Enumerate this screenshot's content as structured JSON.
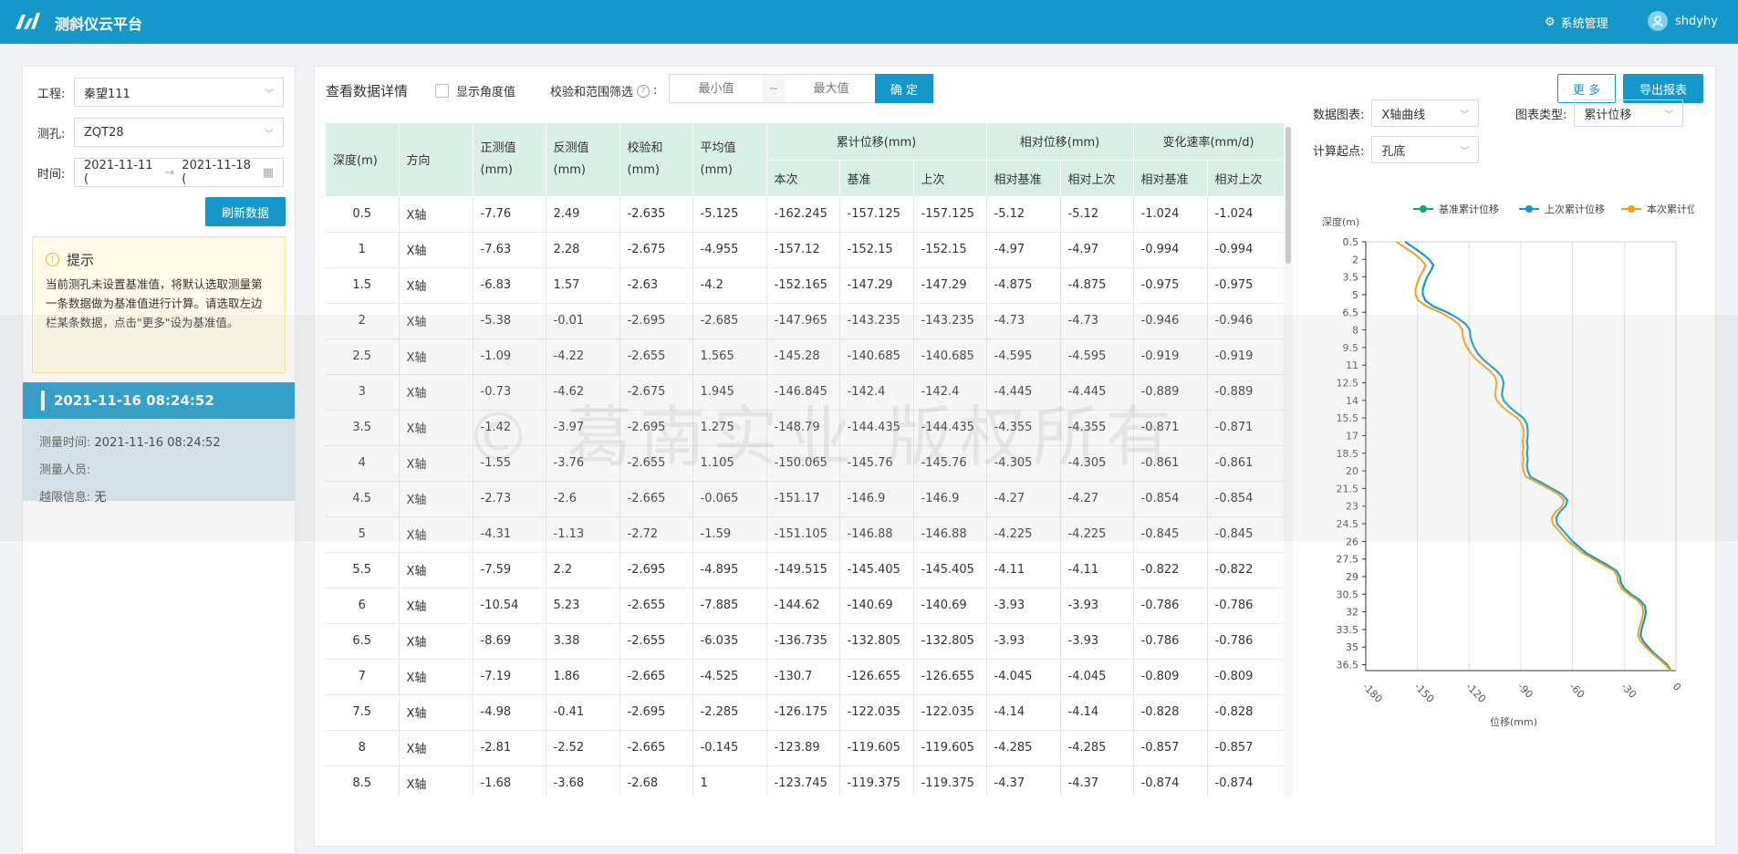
{
  "app": {
    "title": "测斜仪云平台",
    "sys_menu": "系统管理",
    "user": "shdyhy"
  },
  "sidebar": {
    "project_label": "工程:",
    "project_value": "秦望111",
    "hole_label": "测孔:",
    "hole_value": "ZQT28",
    "time_label": "时间:",
    "time_start": "2021-11-11 (",
    "time_sep": "→",
    "time_end": "2021-11-18 (",
    "refresh_label": "刷新数据",
    "tip_title": "提示",
    "tip_text": "当前测孔未设置基准值，将默认选取测量第一条数据做为基准值进行计算。请选取左边栏某条数据，点击\"更多\"设为基准值。",
    "record_title": "2021-11-16 08:24:52",
    "record_time_label": "测量时间:",
    "record_time_value": "2021-11-16 08:24:52",
    "record_person_label": "测量人员:",
    "record_person_value": "",
    "record_limit_label": "越限信息:",
    "record_limit_value": "无"
  },
  "toolbar": {
    "title": "查看数据详情",
    "show_angle": "显示角度值",
    "filter_label": "校验和范围筛选",
    "min_placeholder": "最小值",
    "max_placeholder": "最大值",
    "range_sep": "~",
    "confirm": "确 定",
    "more": "更 多",
    "export": "导出报表"
  },
  "table": {
    "h_depth": "深度(m)",
    "h_dir": "方向",
    "h_pos": "正测值(mm)",
    "h_neg": "反测值(mm)",
    "h_check": "校验和(mm)",
    "h_avg": "平均值(mm)",
    "h_cum": "累计位移(mm)",
    "h_rel": "相对位移(mm)",
    "h_rate": "变化速率(mm/d)",
    "h_cum_now": "本次",
    "h_cum_base": "基准",
    "h_cum_prev": "上次",
    "h_rel_base": "相对基准",
    "h_rel_prev": "相对上次",
    "h_rate_base": "相对基准",
    "h_rate_prev": "相对上次",
    "rows": [
      [
        "0.5",
        "X轴",
        "-7.76",
        "2.49",
        "-2.635",
        "-5.125",
        "-162.245",
        "-157.125",
        "-157.125",
        "-5.12",
        "-5.12",
        "-1.024",
        "-1.024"
      ],
      [
        "1",
        "X轴",
        "-7.63",
        "2.28",
        "-2.675",
        "-4.955",
        "-157.12",
        "-152.15",
        "-152.15",
        "-4.97",
        "-4.97",
        "-0.994",
        "-0.994"
      ],
      [
        "1.5",
        "X轴",
        "-6.83",
        "1.57",
        "-2.63",
        "-4.2",
        "-152.165",
        "-147.29",
        "-147.29",
        "-4.875",
        "-4.875",
        "-0.975",
        "-0.975"
      ],
      [
        "2",
        "X轴",
        "-5.38",
        "-0.01",
        "-2.695",
        "-2.685",
        "-147.965",
        "-143.235",
        "-143.235",
        "-4.73",
        "-4.73",
        "-0.946",
        "-0.946"
      ],
      [
        "2.5",
        "X轴",
        "-1.09",
        "-4.22",
        "-2.655",
        "1.565",
        "-145.28",
        "-140.685",
        "-140.685",
        "-4.595",
        "-4.595",
        "-0.919",
        "-0.919"
      ],
      [
        "3",
        "X轴",
        "-0.73",
        "-4.62",
        "-2.675",
        "1.945",
        "-146.845",
        "-142.4",
        "-142.4",
        "-4.445",
        "-4.445",
        "-0.889",
        "-0.889"
      ],
      [
        "3.5",
        "X轴",
        "-1.42",
        "-3.97",
        "-2.695",
        "1.275",
        "-148.79",
        "-144.435",
        "-144.435",
        "-4.355",
        "-4.355",
        "-0.871",
        "-0.871"
      ],
      [
        "4",
        "X轴",
        "-1.55",
        "-3.76",
        "-2.655",
        "1.105",
        "-150.065",
        "-145.76",
        "-145.76",
        "-4.305",
        "-4.305",
        "-0.861",
        "-0.861"
      ],
      [
        "4.5",
        "X轴",
        "-2.73",
        "-2.6",
        "-2.665",
        "-0.065",
        "-151.17",
        "-146.9",
        "-146.9",
        "-4.27",
        "-4.27",
        "-0.854",
        "-0.854"
      ],
      [
        "5",
        "X轴",
        "-4.31",
        "-1.13",
        "-2.72",
        "-1.59",
        "-151.105",
        "-146.88",
        "-146.88",
        "-4.225",
        "-4.225",
        "-0.845",
        "-0.845"
      ],
      [
        "5.5",
        "X轴",
        "-7.59",
        "2.2",
        "-2.695",
        "-4.895",
        "-149.515",
        "-145.405",
        "-145.405",
        "-4.11",
        "-4.11",
        "-0.822",
        "-0.822"
      ],
      [
        "6",
        "X轴",
        "-10.54",
        "5.23",
        "-2.655",
        "-7.885",
        "-144.62",
        "-140.69",
        "-140.69",
        "-3.93",
        "-3.93",
        "-0.786",
        "-0.786"
      ],
      [
        "6.5",
        "X轴",
        "-8.69",
        "3.38",
        "-2.655",
        "-6.035",
        "-136.735",
        "-132.805",
        "-132.805",
        "-3.93",
        "-3.93",
        "-0.786",
        "-0.786"
      ],
      [
        "7",
        "X轴",
        "-7.19",
        "1.86",
        "-2.665",
        "-4.525",
        "-130.7",
        "-126.655",
        "-126.655",
        "-4.045",
        "-4.045",
        "-0.809",
        "-0.809"
      ],
      [
        "7.5",
        "X轴",
        "-4.98",
        "-0.41",
        "-2.695",
        "-2.285",
        "-126.175",
        "-122.035",
        "-122.035",
        "-4.14",
        "-4.14",
        "-0.828",
        "-0.828"
      ],
      [
        "8",
        "X轴",
        "-2.81",
        "-2.52",
        "-2.665",
        "-0.145",
        "-123.89",
        "-119.605",
        "-119.605",
        "-4.285",
        "-4.285",
        "-0.857",
        "-0.857"
      ],
      [
        "8.5",
        "X轴",
        "-1.68",
        "-3.68",
        "-2.68",
        "1",
        "-123.745",
        "-119.375",
        "-119.375",
        "-4.37",
        "-4.37",
        "-0.874",
        "-0.874"
      ]
    ]
  },
  "chart_opts": {
    "data_chart_label": "数据图表:",
    "data_chart_value": "X轴曲线",
    "chart_type_label": "图表类型:",
    "chart_type_value": "累计位移",
    "calc_start_label": "计算起点:",
    "calc_start_value": "孔底"
  },
  "watermark": "© 葛南实业 版权所有",
  "chart_data": {
    "type": "line",
    "ylabel": "深度(m)",
    "xlabel": "位移(mm)",
    "xlim": [
      -180,
      0
    ],
    "ylim": [
      0.5,
      37
    ],
    "x_ticks": [
      "-180",
      "-150",
      "-120",
      "-90",
      "-60",
      "-30",
      "0"
    ],
    "y_ticks": [
      "0.5",
      "2",
      "3.5",
      "5",
      "6.5",
      "8",
      "9.5",
      "11",
      "12.5",
      "14",
      "15.5",
      "17",
      "18.5",
      "20",
      "21.5",
      "23",
      "24.5",
      "26",
      "27.5",
      "29",
      "30.5",
      "32",
      "33.5",
      "35",
      "36.5"
    ],
    "depth": [
      0.5,
      1,
      1.5,
      2,
      2.5,
      3,
      3.5,
      4,
      4.5,
      5,
      5.5,
      6,
      6.5,
      7,
      7.5,
      8,
      8.5,
      9,
      9.5,
      10,
      10.5,
      11,
      11.5,
      12,
      12.5,
      13,
      13.5,
      14,
      14.5,
      15,
      15.5,
      16,
      16.5,
      17,
      17.5,
      18,
      18.5,
      19,
      19.5,
      20,
      20.5,
      21,
      21.5,
      22,
      22.5,
      23,
      23.5,
      24,
      24.5,
      25,
      25.5,
      26,
      26.5,
      27,
      27.5,
      28,
      28.5,
      29,
      29.5,
      30,
      30.5,
      31,
      31.5,
      32,
      32.5,
      33,
      33.5,
      34,
      34.5,
      35,
      35.5,
      36,
      36.5,
      37
    ],
    "series": [
      {
        "name": "基准累计位移",
        "color": "#1a9e76",
        "values": [
          -157.125,
          -152.15,
          -147.29,
          -143.235,
          -140.685,
          -142.4,
          -144.435,
          -145.76,
          -146.9,
          -146.88,
          -145.405,
          -140.69,
          -132.805,
          -126.655,
          -122.035,
          -119.605,
          -119.375,
          -118.5,
          -117,
          -115,
          -112,
          -108,
          -104,
          -101,
          -100,
          -100.5,
          -101,
          -100,
          -97,
          -93,
          -88.5,
          -86.5,
          -86,
          -86,
          -86.5,
          -86,
          -86.5,
          -86,
          -86.5,
          -86,
          -84.5,
          -78,
          -72,
          -66,
          -63,
          -64,
          -67.5,
          -69.5,
          -69,
          -66,
          -63,
          -60,
          -56,
          -52,
          -46,
          -40,
          -34.5,
          -32.5,
          -32,
          -30,
          -26,
          -21,
          -18,
          -17.5,
          -18,
          -19,
          -20,
          -20.5,
          -19,
          -16,
          -13,
          -9,
          -5,
          -3
        ]
      },
      {
        "name": "上次累计位移",
        "color": "#1597c9",
        "values": [
          -157.125,
          -152.15,
          -147.29,
          -143.235,
          -140.685,
          -142.4,
          -144.435,
          -145.76,
          -146.9,
          -146.88,
          -145.405,
          -140.69,
          -132.805,
          -126.655,
          -122.035,
          -119.605,
          -119.375,
          -118.5,
          -117,
          -115,
          -112,
          -108,
          -104,
          -101,
          -100,
          -100.5,
          -101,
          -100,
          -97,
          -93,
          -88.5,
          -86.5,
          -86,
          -86,
          -86.5,
          -86,
          -86.5,
          -86,
          -86.5,
          -86,
          -84.5,
          -78,
          -72,
          -66,
          -63,
          -64,
          -67.5,
          -69.5,
          -69,
          -66,
          -63,
          -60,
          -56,
          -52,
          -46,
          -40,
          -34.5,
          -32.5,
          -32,
          -30,
          -26,
          -21,
          -18,
          -17.5,
          -18,
          -19,
          -20,
          -20.5,
          -19,
          -16,
          -13,
          -9,
          -5,
          -3
        ]
      },
      {
        "name": "本次累计位移",
        "color": "#f0a020",
        "values": [
          -162.245,
          -157.12,
          -152.165,
          -147.965,
          -145.28,
          -146.845,
          -148.79,
          -150.065,
          -151.17,
          -151.105,
          -149.515,
          -144.62,
          -136.735,
          -130.7,
          -126.175,
          -123.89,
          -123.745,
          -122.8,
          -121.2,
          -119,
          -116,
          -112,
          -108,
          -105,
          -104,
          -104.5,
          -105,
          -104,
          -101,
          -97,
          -92,
          -89.5,
          -88.5,
          -88.5,
          -89,
          -88.5,
          -89,
          -88.5,
          -89,
          -88.5,
          -87,
          -80.5,
          -74,
          -68,
          -65,
          -66,
          -70,
          -72,
          -71.5,
          -68.5,
          -65.5,
          -62.5,
          -58,
          -54,
          -48,
          -42,
          -36,
          -34,
          -33.5,
          -31.5,
          -27.5,
          -22.5,
          -19.5,
          -19,
          -19.5,
          -20.5,
          -21.5,
          -22,
          -20.5,
          -17.5,
          -14,
          -10,
          -6,
          -3
        ]
      }
    ]
  }
}
